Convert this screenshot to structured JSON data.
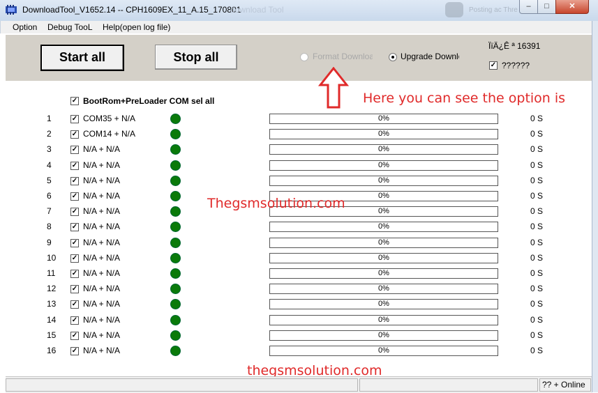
{
  "window": {
    "title": "DownloadTool_V1652.14 -- CPH1609EX_11_A.15_170801",
    "ghost_tab_text": "download Tool",
    "ghost_right_text": "Posting ac Thre"
  },
  "menu": [
    "Option",
    "Debug TooL",
    "Help(open log file)"
  ],
  "toolbar": {
    "start_label": "Start all",
    "stop_label": "Stop all",
    "format_label": "Format Download",
    "upgrade_label": "Upgrade Download",
    "garbled_text": "ÏïÄ¿Ê ª 16391",
    "check_label": "??????"
  },
  "header": {
    "select_all_label": "BootRom+PreLoader COM sel all"
  },
  "rows": [
    {
      "num": "1",
      "label": "COM35 + N/A",
      "progress": "0%",
      "time": "0 S"
    },
    {
      "num": "2",
      "label": "COM14 + N/A",
      "progress": "0%",
      "time": "0 S"
    },
    {
      "num": "3",
      "label": "N/A + N/A",
      "progress": "0%",
      "time": "0 S"
    },
    {
      "num": "4",
      "label": "N/A + N/A",
      "progress": "0%",
      "time": "0 S"
    },
    {
      "num": "5",
      "label": "N/A + N/A",
      "progress": "0%",
      "time": "0 S"
    },
    {
      "num": "6",
      "label": "N/A + N/A",
      "progress": "0%",
      "time": "0 S"
    },
    {
      "num": "7",
      "label": "N/A + N/A",
      "progress": "0%",
      "time": "0 S"
    },
    {
      "num": "8",
      "label": "N/A + N/A",
      "progress": "0%",
      "time": "0 S"
    },
    {
      "num": "9",
      "label": "N/A + N/A",
      "progress": "0%",
      "time": "0 S"
    },
    {
      "num": "10",
      "label": "N/A + N/A",
      "progress": "0%",
      "time": "0 S"
    },
    {
      "num": "11",
      "label": "N/A + N/A",
      "progress": "0%",
      "time": "0 S"
    },
    {
      "num": "12",
      "label": "N/A + N/A",
      "progress": "0%",
      "time": "0 S"
    },
    {
      "num": "13",
      "label": "N/A + N/A",
      "progress": "0%",
      "time": "0 S"
    },
    {
      "num": "14",
      "label": "N/A + N/A",
      "progress": "0%",
      "time": "0 S"
    },
    {
      "num": "15",
      "label": "N/A + N/A",
      "progress": "0%",
      "time": "0 S"
    },
    {
      "num": "16",
      "label": "N/A + N/A",
      "progress": "0%",
      "time": "0 S"
    }
  ],
  "annotations": {
    "note": "Here you can see the option is",
    "watermark1": "Thegsmsolution.com",
    "watermark2": "thegsmsolution.com",
    "color": "#e02a2a"
  },
  "statusbar": {
    "online_label": "?? + Online"
  },
  "colors": {
    "led": "#0a7a0a",
    "toolbar_bg": "#d4d0c8"
  }
}
